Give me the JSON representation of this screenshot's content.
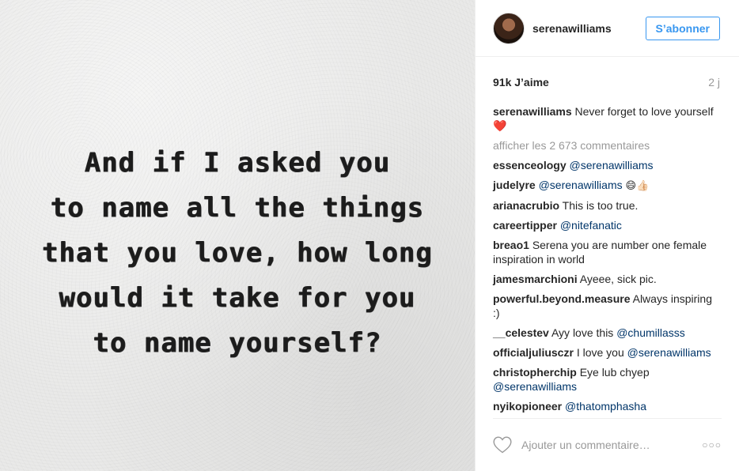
{
  "photo": {
    "quote_lines": [
      "And if I asked you",
      "to name all the things",
      "that you love, how long",
      "would it take for you",
      "to name yourself?"
    ]
  },
  "header": {
    "username": "serenawilliams",
    "follow_label": "S’abonner"
  },
  "meta": {
    "likes": "91k J’aime",
    "time": "2 j"
  },
  "caption": {
    "user": "serenawilliams",
    "text": "Never forget to love yourself",
    "emoji": "❤️"
  },
  "view_all_comments": "afficher les 2 673 commentaires",
  "comments": [
    {
      "user": "essenceology",
      "text": "",
      "mention": "@serenawilliams",
      "emoji": ""
    },
    {
      "user": "judelyre",
      "text": "",
      "mention": "@serenawilliams",
      "emoji": "😄👍🏻"
    },
    {
      "user": "arianacrubio",
      "text": "This is too true.",
      "mention": "",
      "emoji": ""
    },
    {
      "user": "careertipper",
      "text": "",
      "mention": "@nitefanatic",
      "emoji": ""
    },
    {
      "user": "breao1",
      "text": "Serena you are number one female inspiration in world",
      "mention": "",
      "emoji": ""
    },
    {
      "user": "jamesmarchioni",
      "text": "Ayeee, sick pic.",
      "mention": "",
      "emoji": ""
    },
    {
      "user": "powerful.beyond.measure",
      "text": "Always inspiring :)",
      "mention": "",
      "emoji": ""
    },
    {
      "user": "__celestev",
      "text": "Ayy love this",
      "mention": "@chumillasss",
      "emoji": ""
    },
    {
      "user": "officialjuliusczr",
      "text": "I love you",
      "mention": "@serenawilliams",
      "emoji": ""
    },
    {
      "user": "christopherchip",
      "text": "Eye lub chyep",
      "mention": "@serenawilliams",
      "emoji": ""
    },
    {
      "user": "nyikopioneer",
      "text": "",
      "mention": "@thatomphasha",
      "emoji": ""
    }
  ],
  "footer": {
    "comment_placeholder": "Ajouter un commentaire…",
    "more_glyph": "○○○"
  },
  "icons": {
    "like": "heart-outline-icon",
    "more": "more-options-icon"
  },
  "colors": {
    "accent": "#3897f0",
    "mention": "#003569",
    "muted": "#999999",
    "text": "#262626"
  }
}
